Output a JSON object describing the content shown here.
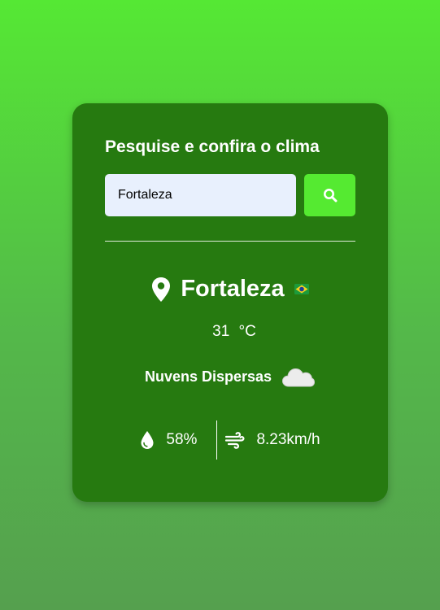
{
  "search": {
    "title": "Pesquise e confira o clima",
    "input_value": "Fortaleza",
    "button_icon": "search-icon"
  },
  "weather": {
    "city": "Fortaleza",
    "flag_icon": "brazil-flag-icon",
    "temperature": "31",
    "unit": "°C",
    "description": "Nuvens Dispersas",
    "description_icon": "cloud-icon",
    "humidity": "58%",
    "wind": "8.23km/h"
  },
  "colors": {
    "card": "#267a10",
    "button": "#55ea31",
    "input": "#e8f0fd",
    "background_top": "#55e834",
    "background_bottom": "#55a04e"
  }
}
